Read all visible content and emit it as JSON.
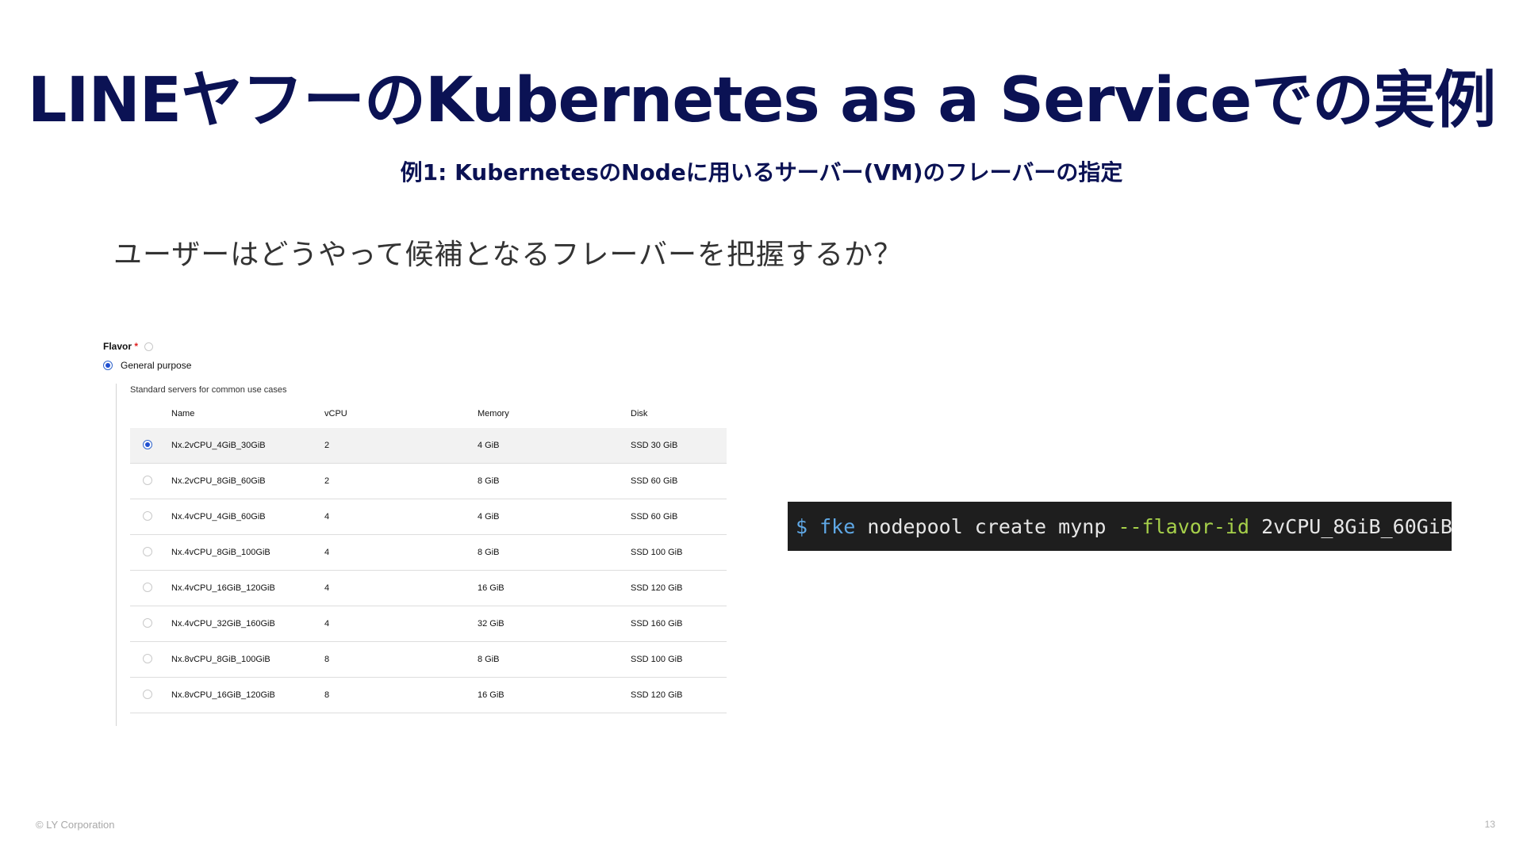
{
  "slide": {
    "title": "LINEヤフーのKubernetes as a Serviceでの実例",
    "subtitle": "例1: KubernetesのNodeに用いるサーバー(VM)のフレーバーの指定",
    "question": "ユーザーはどうやって候補となるフレーバーを把握するか？"
  },
  "flavor": {
    "label": "Flavor",
    "required_mark": "*",
    "category": "General purpose",
    "description": "Standard servers for common use cases",
    "columns": [
      "Name",
      "vCPU",
      "Memory",
      "Disk"
    ],
    "rows": [
      {
        "name": "Nx.2vCPU_4GiB_30GiB",
        "vcpu": "2",
        "memory": "4 GiB",
        "disk": "SSD 30 GiB",
        "selected": true
      },
      {
        "name": "Nx.2vCPU_8GiB_60GiB",
        "vcpu": "2",
        "memory": "8 GiB",
        "disk": "SSD 60 GiB",
        "selected": false
      },
      {
        "name": "Nx.4vCPU_4GiB_60GiB",
        "vcpu": "4",
        "memory": "4 GiB",
        "disk": "SSD 60 GiB",
        "selected": false
      },
      {
        "name": "Nx.4vCPU_8GiB_100GiB",
        "vcpu": "4",
        "memory": "8 GiB",
        "disk": "SSD 100 GiB",
        "selected": false
      },
      {
        "name": "Nx.4vCPU_16GiB_120GiB",
        "vcpu": "4",
        "memory": "16 GiB",
        "disk": "SSD 120 GiB",
        "selected": false
      },
      {
        "name": "Nx.4vCPU_32GiB_160GiB",
        "vcpu": "4",
        "memory": "32 GiB",
        "disk": "SSD 160 GiB",
        "selected": false
      },
      {
        "name": "Nx.8vCPU_8GiB_100GiB",
        "vcpu": "8",
        "memory": "8 GiB",
        "disk": "SSD 100 GiB",
        "selected": false
      },
      {
        "name": "Nx.8vCPU_16GiB_120GiB",
        "vcpu": "8",
        "memory": "16 GiB",
        "disk": "SSD 120 GiB",
        "selected": false
      }
    ]
  },
  "terminal": {
    "prompt": "$",
    "command": "fke",
    "args": "nodepool create mynp",
    "flag": "--flavor-id",
    "value": "2vCPU_8GiB_60GiB"
  },
  "footer": {
    "copyright": "© LY Corporation",
    "page_number": "13"
  },
  "colors": {
    "title": "#0b1254",
    "terminal_bg": "#1e1e1e",
    "terminal_cmd": "#5fa8e6",
    "terminal_flag": "#a6d04a",
    "radio_selected": "#1f4fd1"
  }
}
